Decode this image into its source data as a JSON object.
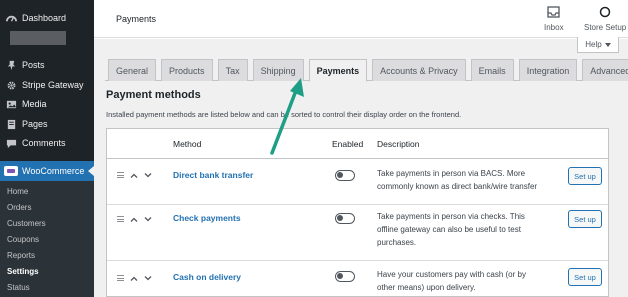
{
  "sidebar": {
    "menu": [
      {
        "label": "Dashboard",
        "icon": "dashboard-icon"
      },
      {
        "label": "Posts",
        "icon": "pin-icon"
      },
      {
        "label": "Stripe Gateway",
        "icon": "gear-icon"
      },
      {
        "label": "Media",
        "icon": "media-icon"
      },
      {
        "label": "Pages",
        "icon": "page-icon"
      },
      {
        "label": "Comments",
        "icon": "comment-icon"
      }
    ],
    "woocommerce": "WooCommerce",
    "submenu": [
      "Home",
      "Orders",
      "Customers",
      "Coupons",
      "Reports",
      "Settings",
      "Status"
    ],
    "current_submenu": "Settings"
  },
  "header": {
    "title": "Payments",
    "inbox_label": "Inbox",
    "store_setup_label": "Store Setup",
    "help_label": "Help"
  },
  "tabs": [
    "General",
    "Products",
    "Tax",
    "Shipping",
    "Payments",
    "Accounts & Privacy",
    "Emails",
    "Integration",
    "Advanced"
  ],
  "active_tab": "Payments",
  "section": {
    "title": "Payment methods",
    "description": "Installed payment methods are listed below and can be sorted to control their display order on the frontend."
  },
  "table": {
    "columns": {
      "method": "Method",
      "enabled": "Enabled",
      "description": "Description"
    },
    "rows": [
      {
        "name": "Direct bank transfer",
        "enabled": false,
        "desc_line1": "Take payments in person via BACS. More",
        "desc_line2": "commonly known as direct bank/wire transfer",
        "desc_line3": "",
        "action": "Set up"
      },
      {
        "name": "Check payments",
        "enabled": false,
        "desc_line1": "Take payments in person via checks. This",
        "desc_line2": "offline gateway can also be useful to test",
        "desc_line3": "purchases.",
        "action": "Set up"
      },
      {
        "name": "Cash on delivery",
        "enabled": false,
        "desc_line1": "Have your customers pay with cash (or by",
        "desc_line2": "other means) upon delivery.",
        "desc_line3": "",
        "action": "Set up"
      }
    ]
  },
  "colors": {
    "sidebar_bg": "#1d2327",
    "accent": "#2271b1",
    "annotation_arrow": "#1f9e86"
  }
}
